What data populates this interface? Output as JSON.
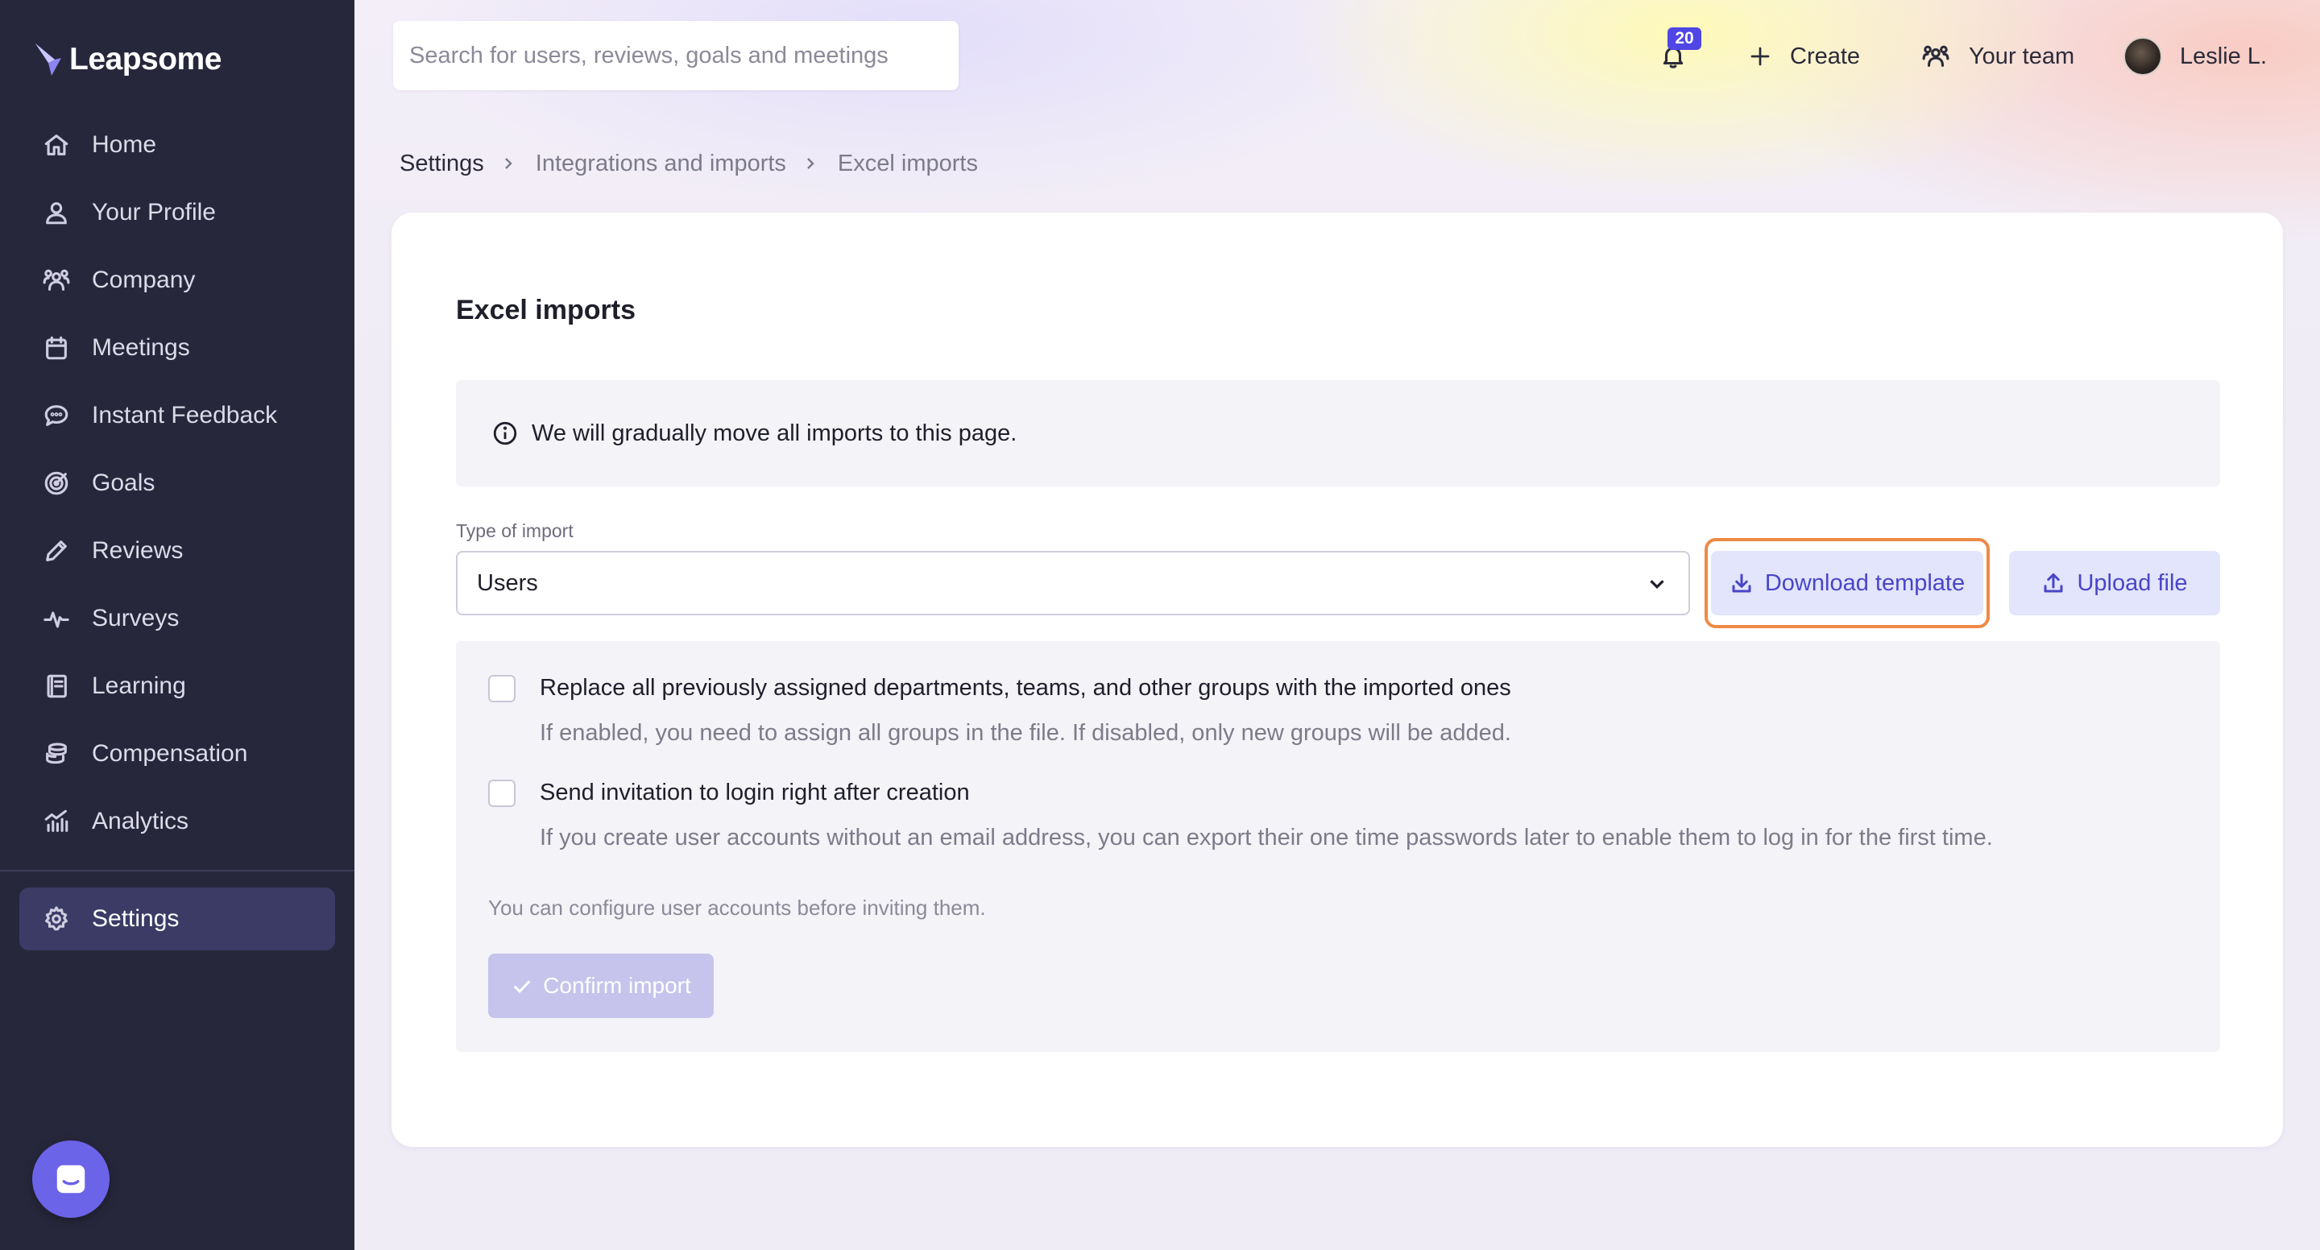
{
  "app": {
    "name": "Leapsome"
  },
  "sidebar": {
    "items": [
      {
        "label": "Home",
        "icon": "home-icon"
      },
      {
        "label": "Your Profile",
        "icon": "user-icon"
      },
      {
        "label": "Company",
        "icon": "people-icon"
      },
      {
        "label": "Meetings",
        "icon": "calendar-icon"
      },
      {
        "label": "Instant Feedback",
        "icon": "chat-bubble-icon"
      },
      {
        "label": "Goals",
        "icon": "target-icon"
      },
      {
        "label": "Reviews",
        "icon": "pencil-icon"
      },
      {
        "label": "Surveys",
        "icon": "pulse-icon"
      },
      {
        "label": "Learning",
        "icon": "book-icon"
      },
      {
        "label": "Compensation",
        "icon": "coins-icon"
      },
      {
        "label": "Analytics",
        "icon": "bar-chart-icon"
      }
    ],
    "settings_label": "Settings",
    "active": "Settings"
  },
  "topbar": {
    "search_placeholder": "Search for users, reviews, goals and meetings",
    "notifications_count": "20",
    "create_label": "Create",
    "team_label": "Your team",
    "user_name": "Leslie L."
  },
  "breadcrumb": [
    "Settings",
    "Integrations and imports",
    "Excel imports"
  ],
  "page": {
    "title": "Excel imports",
    "info_text": "We will gradually move all imports to this page.",
    "type_label": "Type of import",
    "type_value": "Users",
    "download_label": "Download template",
    "upload_label": "Upload file",
    "options": [
      {
        "title": "Replace all previously assigned departments, teams, and other groups with the imported ones",
        "description": "If enabled, you need to assign all groups in the file. If disabled, only new groups will be added.",
        "checked": false
      },
      {
        "title": "Send invitation to login right after creation",
        "description": "If you create user accounts without an email address, you can export their one time passwords later to enable them to log in for the first time.",
        "checked": false
      }
    ],
    "configure_note": "You can configure user accounts before inviting them.",
    "confirm_label": "Confirm import"
  },
  "colors": {
    "sidebar_bg": "#27273c",
    "accent": "#4f46e5",
    "highlight": "#ee8a45"
  }
}
